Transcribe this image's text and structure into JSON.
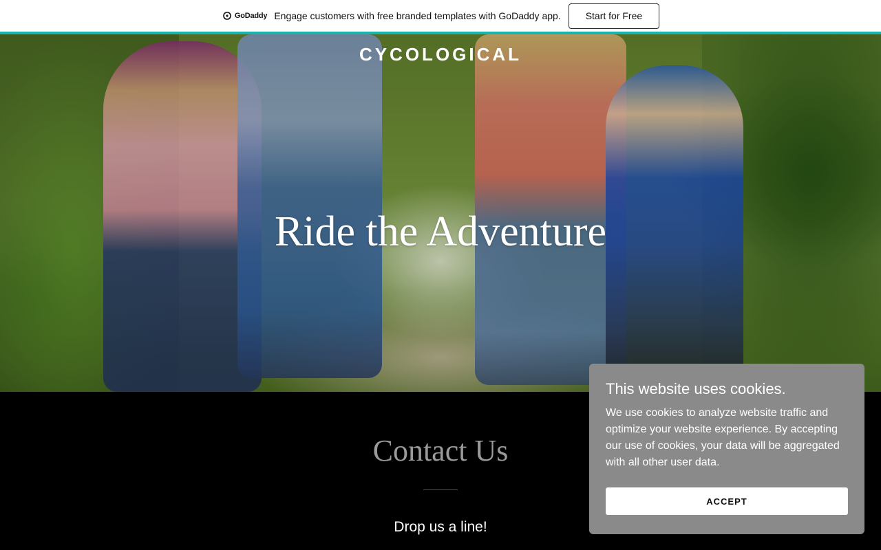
{
  "promo": {
    "logo_text": "GoDaddy",
    "message": "Engage customers with free branded templates with GoDaddy app.",
    "cta_label": "Start for Free"
  },
  "hero": {
    "brand": "CYCOLOGICAL",
    "heading": "Ride the Adventure"
  },
  "contact": {
    "title": "Contact Us",
    "subtitle": "Drop us a line!"
  },
  "cookie": {
    "title": "This website uses cookies.",
    "body": "We use cookies to analyze website traffic and optimize your website experience. By accepting our use of cookies, your data will be aggregated with all other user data.",
    "accept_label": "ACCEPT"
  },
  "colors": {
    "accent": "#1bb3ad",
    "cookie_bg": "#8a8a8a",
    "contact_bg": "#000000"
  }
}
